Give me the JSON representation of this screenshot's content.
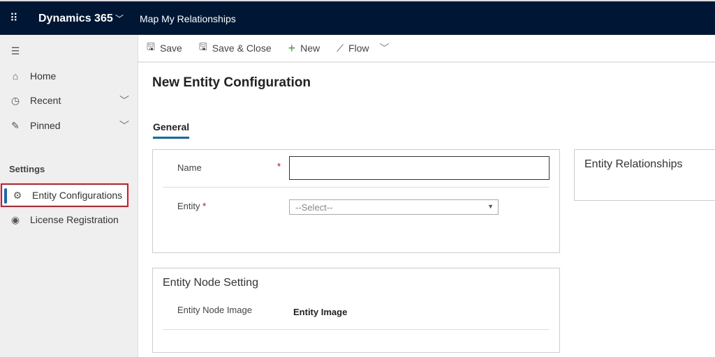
{
  "header": {
    "brand": "Dynamics 365",
    "app_name": "Map My Relationships"
  },
  "sidebar": {
    "items": [
      {
        "label": "Home",
        "icon": "home-icon"
      },
      {
        "label": "Recent",
        "icon": "clock-icon"
      },
      {
        "label": "Pinned",
        "icon": "pin-icon"
      }
    ],
    "section": "Settings",
    "settings_items": [
      {
        "label": "Entity Configurations",
        "icon": "gears-icon",
        "active": true
      },
      {
        "label": "License Registration",
        "icon": "license-icon"
      }
    ]
  },
  "toolbar": {
    "save": "Save",
    "save_close": "Save & Close",
    "new": "New",
    "flow": "Flow"
  },
  "page": {
    "title": "New Entity Configuration",
    "tab": "General"
  },
  "form": {
    "name_label": "Name",
    "name_value": "",
    "entity_label": "Entity",
    "entity_select": "--Select--",
    "required_mark": "*"
  },
  "relationships": {
    "title": "Entity Relationships"
  },
  "node_setting": {
    "title": "Entity Node Setting",
    "image_label": "Entity Node Image",
    "image_value": "Entity Image"
  },
  "colors": {
    "header": "#001635",
    "accent": "#0f6cbd",
    "highlight": "#e81123"
  }
}
